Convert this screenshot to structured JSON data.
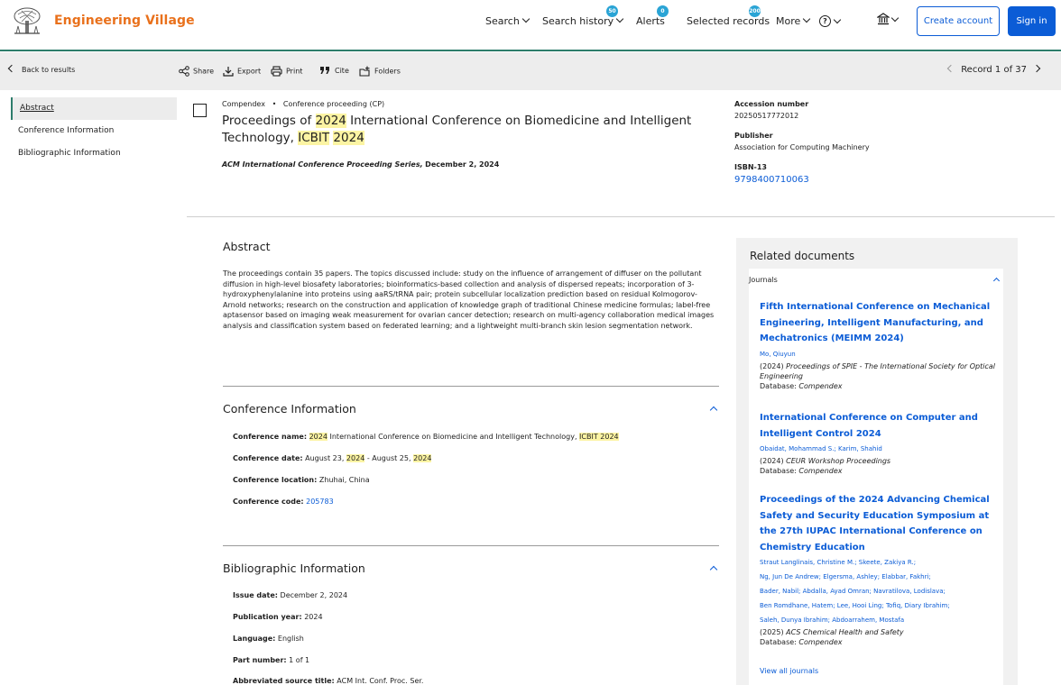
{
  "header": {
    "brand": "Engineering Village",
    "nav": {
      "search": "Search",
      "search_history": "Search history",
      "search_history_count": "50",
      "alerts": "Alerts",
      "alerts_count": "0",
      "selected_records": "Selected records",
      "selected_records_count": "200",
      "more": "More"
    },
    "help_glyph": "?",
    "create_account": "Create account",
    "sign_in": "Sign in"
  },
  "toolbar": {
    "back": "Back to results",
    "share": "Share",
    "export": "Export",
    "print": "Print",
    "cite": "Cite",
    "folders": "Folders",
    "record_nav": "Record 1 of 37"
  },
  "left_nav": {
    "items": [
      "Abstract",
      "Conference Information",
      "Bibliographic Information"
    ]
  },
  "record": {
    "database": "Compendex",
    "doc_type": "Conference proceeding (CP)",
    "title_parts": [
      "Proceedings of ",
      "2024",
      " International Conference on Biomedicine and Intelligent Technology, ",
      "ICBIT",
      " ",
      "2024"
    ],
    "series": "ACM International Conference Proceeding Series,",
    "date": "December 2, 2024"
  },
  "side_meta": {
    "accession_label": "Accession number",
    "accession_value": "20250517772012",
    "publisher_label": "Publisher",
    "publisher_value": "Association for Computing Machinery",
    "isbn_label": "ISBN-13",
    "isbn_value": "9798400710063"
  },
  "abstract": {
    "title": "Abstract",
    "text": "The proceedings contain 35 papers. The topics discussed include: study on the influence of arrangement of diffuser on the pollutant diffusion in high-level biosafety laboratories; bioinformatics-based collection and analysis of dispersed repeats; incorporation of 3-hydroxyphenylalanine into proteins using aaRS/tRNA pair; protein subcellular localization prediction based on residual Kolmogorov-Arnold networks; research on the construction and application of knowledge graph of traditional Chinese medicine formulas; label-free aptasensor based on imaging weak measurement for ovarian cancer detection; research on multi-agency collaboration medical images analysis and classification system based on federated learning; and a lightweight multi-branch skin lesion segmentation network."
  },
  "conference": {
    "title": "Conference Information",
    "name_label": "Conference name:",
    "name_parts": [
      "2024",
      " International Conference on Biomedicine and Intelligent Technology, ",
      "ICBIT 2024"
    ],
    "date_label": "Conference date:",
    "date_parts": [
      "August 23, ",
      "2024",
      " - August 25, ",
      "2024"
    ],
    "location_label": "Conference location:",
    "location_value": "Zhuhai, China",
    "code_label": "Conference code:",
    "code_value": "205783"
  },
  "bibliographic": {
    "title": "Bibliographic Information",
    "issue_date_label": "Issue date:",
    "issue_date_value": "December 2, 2024",
    "pub_year_label": "Publication year:",
    "pub_year_value": "2024",
    "language_label": "Language:",
    "language_value": "English",
    "part_label": "Part number:",
    "part_value": "1 of 1",
    "abbrev_label": "Abbreviated source title:",
    "abbrev_value": "ACM Int. Conf. Proc. Ser."
  },
  "related": {
    "title": "Related documents",
    "journals_label": "Journals",
    "items": [
      {
        "title": "Fifth International Conference on Mechanical Engineering, Intelligent Manufacturing, and Mechatronics (MEIMM 2024)",
        "authors": [
          "Mo, Qiuyun"
        ],
        "year": "(2024)",
        "source": "Proceedings of SPIE - The International Society for Optical Engineering",
        "database": "Database:",
        "database_value": "Compendex"
      },
      {
        "title": "International Conference on Computer and Intelligent Control 2024",
        "authors": [
          "Obaidat, Mohammad S.; Karim, Shahid"
        ],
        "year": "(2024)",
        "source": "CEUR Workshop Proceedings",
        "database": "Database:",
        "database_value": "Compendex"
      },
      {
        "title": "Proceedings of the 2024 Advancing Chemical Safety and Security Education Symposium at the 27th IUPAC International Conference on Chemistry Education",
        "authors": [
          "Straut Langlinais, Christine M.; Skeete, Zakiya R.;",
          "Ng, Jun De Andrew; Elgersma, Ashley; Elabbar, Fakhri;",
          "Bader, Nabil; Abdalla, Ayad Omran; Navratilova, Lodislava;",
          "Ben Romdhane, Hatem; Lee, Hooi Ling; Tofiq, Diary Ibrahim;",
          "Saleh, Dunya Ibrahim; Abdoarrahem, Mostafa"
        ],
        "year": "(2025)",
        "source": "ACS Chemical Health and Safety",
        "database": "Database:",
        "database_value": "Compendex"
      }
    ],
    "view_all": "View all journals"
  }
}
